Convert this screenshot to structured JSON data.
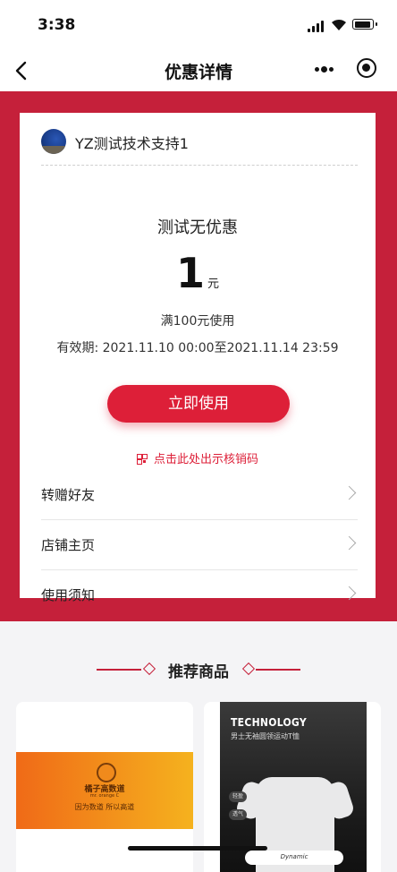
{
  "status_bar": {
    "time": "3:38"
  },
  "nav": {
    "title": "优惠详情",
    "back_icon": "chevron-left-icon",
    "more_icon": "more-dots-icon",
    "close_icon": "target-icon"
  },
  "coupon": {
    "shop_name": "YZ测试技术支持1",
    "title": "测试无优惠",
    "amount": "1",
    "unit": "元",
    "condition": "满100元使用",
    "validity": "有效期: 2021.11.10 00:00至2021.11.14 23:59",
    "use_button": "立即使用",
    "qr_link": "点击此处出示核销码"
  },
  "menu": [
    {
      "label": "转赠好友"
    },
    {
      "label": "店铺主页"
    },
    {
      "label": "使用须知"
    }
  ],
  "recommend": {
    "title": "推荐商品",
    "products": [
      {
        "brand": "橘子高数道",
        "sub": "mr. orange C",
        "slogan": "因为数道 所以高道"
      },
      {
        "headline": "TECHNOLOGY",
        "desc": "男士无袖圆领运动T恤",
        "tags": [
          "轻盈",
          "透气"
        ],
        "brand": "Dynamic"
      }
    ]
  },
  "colors": {
    "accent": "#c5203a",
    "button": "#dd1f38"
  }
}
